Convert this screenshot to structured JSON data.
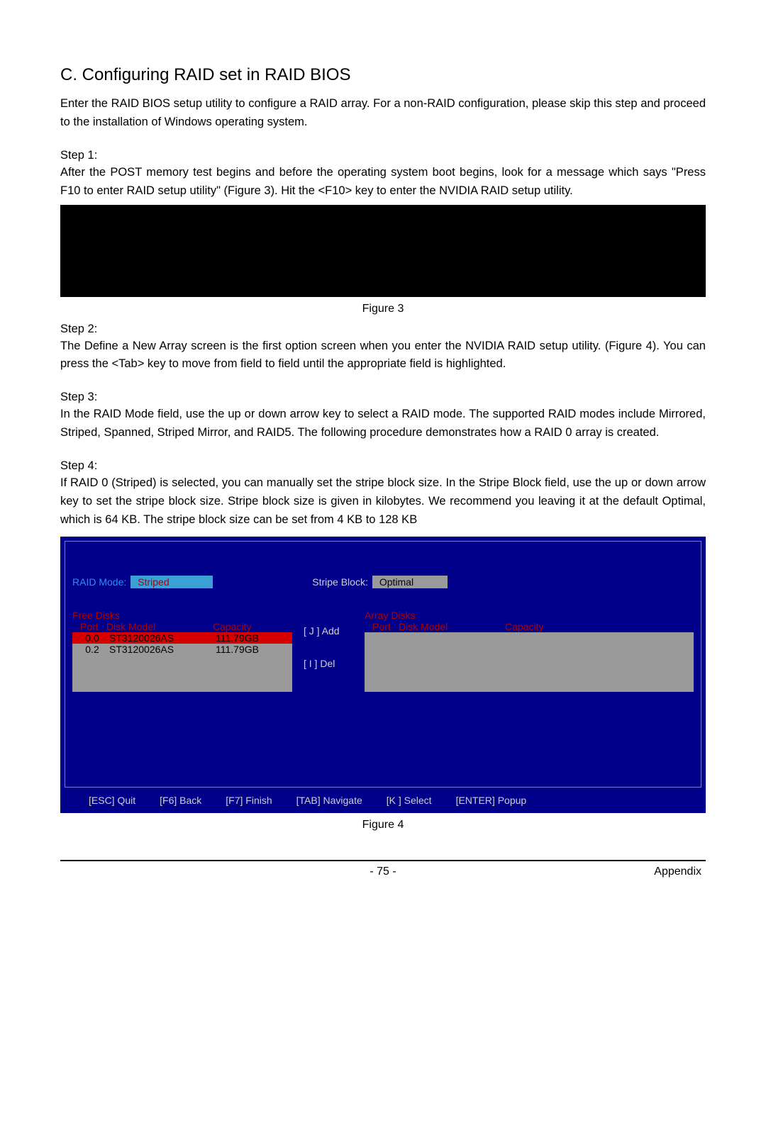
{
  "title": "C. Configuring RAID set in RAID BIOS",
  "intro": "Enter the RAID BIOS setup utility to configure a RAID array. For a non-RAID configuration, please skip this step and proceed to the installation of Windows operating system.",
  "step1_label": "Step 1:",
  "step1_body": "After the POST memory test begins and before the operating system boot begins, look for a message which says \"Press F10 to enter RAID setup utility\" (Figure 3). Hit the <F10> key to enter the NVIDIA RAID setup utility.",
  "fig3_caption": "Figure 3",
  "step2_label": "Step 2:",
  "step2_body_a": "The ",
  "step2_body_bold": "Define a New Array",
  "step2_body_b": " screen is the first option screen when you enter the NVIDIA RAID setup utility. (Figure 4). You can press the <Tab> key to move from field to field until the appropriate field is highlighted.",
  "step3_label": "Step 3:",
  "step3_body": "In the RAID Mode field, use the up or down arrow key to select a RAID mode. The supported RAID modes include Mirrored, Striped, Spanned, Striped Mirror, and RAID5. The following procedure demonstrates how a RAID 0 array is created.",
  "step4_label": "Step 4:",
  "step4_body": "If RAID 0 (Striped) is selected, you can manually set the stripe block size. In the Stripe Block field, use the up or down arrow key to set the stripe block size. Stripe block size is given in kilobytes. We recommend you leaving it at the default Optimal, which is 64 KB. The stripe block size can be set from 4 KB to 128 KB",
  "raid": {
    "mode_label": "RAID Mode:",
    "mode_value": "Striped",
    "stripe_label": "Stripe Block:",
    "stripe_value": "Optimal",
    "free_disks_label": "Free Disks",
    "array_disks_label": "Array Disks",
    "col_port": "Port",
    "col_model": "Disk  Model",
    "col_capacity": "Capacity",
    "rows": [
      {
        "port": "0.0",
        "model": "ST3120026AS",
        "capacity": "111.79GB",
        "selected": true
      },
      {
        "port": "0.2",
        "model": "ST3120026AS",
        "capacity": "111.79GB",
        "selected": false
      }
    ],
    "add_label": "[ J ] Add",
    "del_label": "[ I ] Del",
    "keys": {
      "esc": "[ESC] Quit",
      "f6": "[F6] Back",
      "f7": "[F7] Finish",
      "tab": "[TAB] Navigate",
      "sel": "[K ] Select",
      "enter": "[ENTER] Popup"
    }
  },
  "fig4_caption": "Figure 4",
  "page_number": "- 75 -",
  "appendix": "Appendix"
}
